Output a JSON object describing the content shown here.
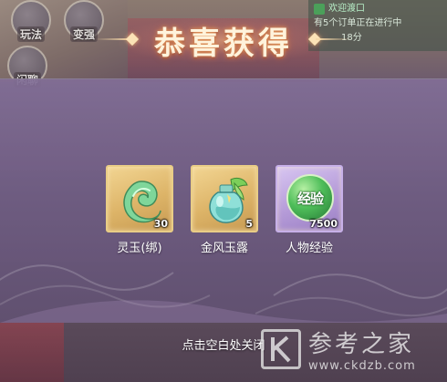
{
  "hud": {
    "buttons": [
      {
        "label": "玩法"
      },
      {
        "label": "变强"
      },
      {
        "label": "闲聊"
      }
    ]
  },
  "quest_panel": {
    "title": "欢迎渡口",
    "line1": "有5个订单正在进行中",
    "line2": "18分"
  },
  "modal": {
    "title": "恭喜获得",
    "rewards": [
      {
        "name": "灵玉(绑)",
        "count": "30",
        "icon": "jade-icon",
        "rarity": "gold"
      },
      {
        "name": "金风玉露",
        "count": "5",
        "icon": "potion-icon",
        "rarity": "gold"
      },
      {
        "name": "人物经验",
        "count": "7500",
        "icon": "exp-orb-icon",
        "icon_text": "经验",
        "rarity": "purple"
      }
    ],
    "close_hint": "点击空白处关闭"
  },
  "watermark": {
    "cn": "参考之家",
    "url": "www.ckdzb.com"
  },
  "colors": {
    "gold_card": "#ddb468",
    "purple_card": "#b59bd8",
    "title_text": "#fff3dc"
  }
}
